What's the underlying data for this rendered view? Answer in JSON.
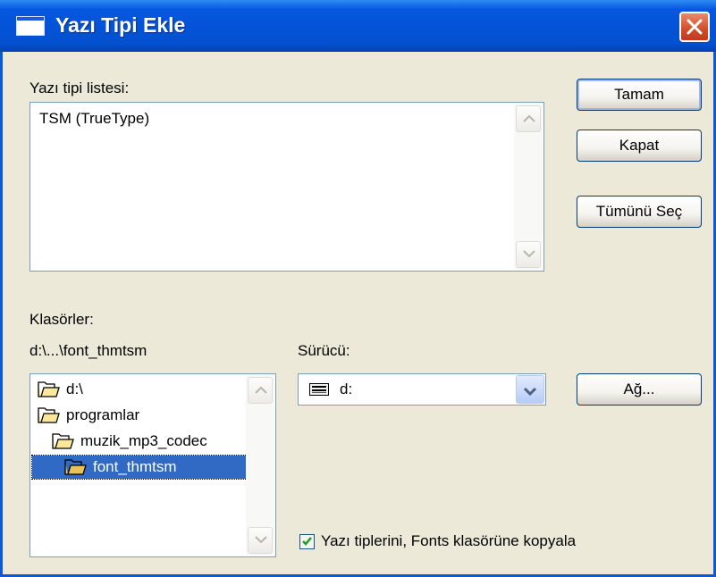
{
  "window": {
    "title": "Yazı Tipi Ekle"
  },
  "font_list": {
    "label": "Yazı tipi listesi:",
    "items": [
      "TSM (TrueType)"
    ]
  },
  "buttons": {
    "ok": "Tamam",
    "close": "Kapat",
    "select_all": "Tümünü Seç",
    "network": "Ağ..."
  },
  "folders": {
    "label": "Klasörler:",
    "current_path": "d:\\...\\font_thmtsm",
    "tree": [
      {
        "name": "d:\\",
        "state": "open"
      },
      {
        "name": "programlar",
        "state": "open"
      },
      {
        "name": "muzik_mp3_codec",
        "state": "open"
      },
      {
        "name": "font_thmtsm",
        "state": "open-selected"
      }
    ]
  },
  "drive": {
    "label": "Sürücü:",
    "selected": "d:"
  },
  "copy_option": {
    "label": "Yazı tiplerini, Fonts klasörüne kopyala",
    "checked": true
  },
  "colors": {
    "titlebar": "#0453d8",
    "selection": "#316ac5",
    "dialog_bg": "#ece9d8",
    "close_button": "#d14d2a"
  }
}
